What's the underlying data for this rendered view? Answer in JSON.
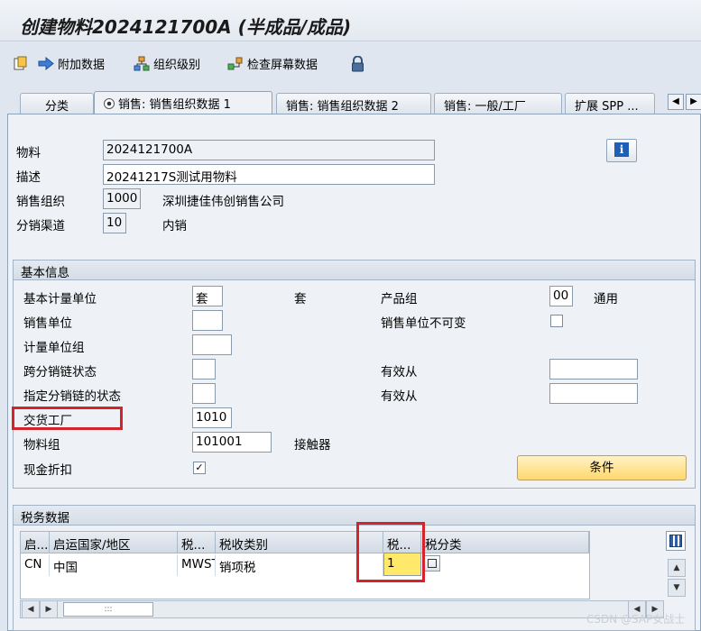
{
  "title": "创建物料2024121700A (半成品/成品)",
  "toolbar": {
    "extra_data": "附加数据",
    "org_levels": "组织级别",
    "check_screen": "检查屏幕数据"
  },
  "tabs": [
    {
      "label": "分类"
    },
    {
      "label": "销售: 销售组织数据 1"
    },
    {
      "label": "销售: 销售组织数据 2"
    },
    {
      "label": "销售: 一般/工厂"
    },
    {
      "label": "扩展 SPP ..."
    }
  ],
  "header": {
    "material_label": "物料",
    "material_value": "2024121700A",
    "desc_label": "描述",
    "desc_value": "20241217S测试用物料",
    "salesorg_label": "销售组织",
    "salesorg_value": "1000",
    "salesorg_text": "深圳捷佳伟创销售公司",
    "channel_label": "分销渠道",
    "channel_value": "10",
    "channel_text": "内销",
    "info_icon": "i"
  },
  "basic": {
    "title": "基本信息",
    "base_uom_label": "基本计量单位",
    "base_uom_value": "套",
    "base_uom_text": "套",
    "division_label": "产品组",
    "division_value": "00",
    "division_text": "通用",
    "sales_unit_label": "销售单位",
    "sales_unit_value": "",
    "sales_unit_fixed_label": "销售单位不可变",
    "uom_group_label": "计量单位组",
    "uom_group_value": "",
    "xchain_status_label": "跨分销链状态",
    "xchain_status_value": "",
    "valid_from_1_label": "有效从",
    "valid_from_1_value": "",
    "dchain_status_label": "指定分销链的状态",
    "dchain_status_value": "",
    "valid_from_2_label": "有效从",
    "valid_from_2_value": "",
    "plant_label": "交货工厂",
    "plant_value": "1010",
    "matgroup_label": "物料组",
    "matgroup_value": "101001",
    "matgroup_text": "接触器",
    "cash_discount_label": "现金折扣",
    "cash_discount_checked": "✓",
    "conditions_button": "条件"
  },
  "tax": {
    "title": "税务数据",
    "columns": [
      "启...",
      "启运国家/地区",
      "税...",
      "税收类别",
      "税...",
      "税分类"
    ],
    "row": {
      "country_code": "CN",
      "country_name": "中国",
      "tax_type": "MWST",
      "tax_category": "销项税",
      "tax_class": "1"
    },
    "scroll_thumb": ":::"
  },
  "watermark": "CSDN @SAP女战士",
  "colors": {
    "accent_red": "#d4232b",
    "button_yellow": "#ffd96d",
    "panel_bg": "#eef2f6"
  }
}
